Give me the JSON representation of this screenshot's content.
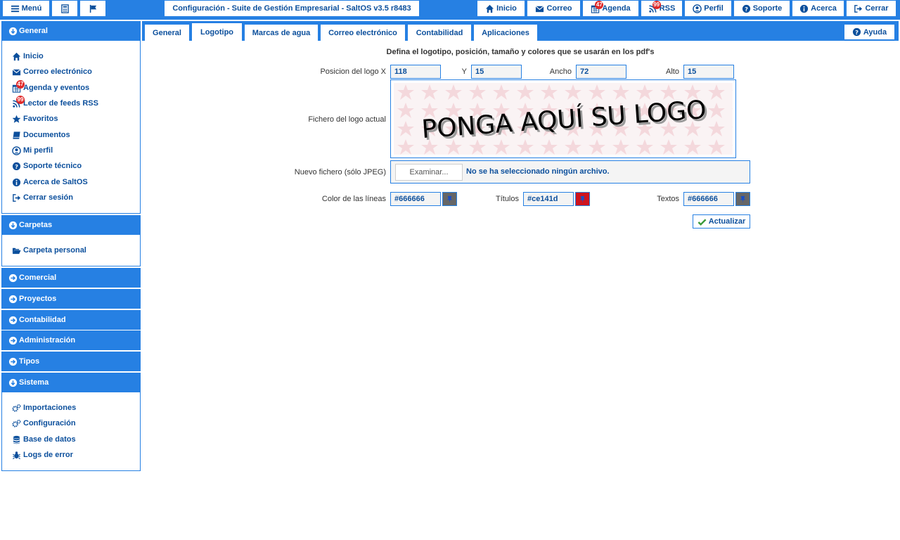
{
  "topbar": {
    "menu": "Menú",
    "title": "Configuración - Suite de Gestión Empresarial - SaltOS v3.5 r8483",
    "inicio": "Inicio",
    "correo": "Correo",
    "agenda": "Agenda",
    "agenda_badge": "47",
    "rss": "RSS",
    "rss_badge": "99",
    "perfil": "Perfil",
    "soporte": "Soporte",
    "acerca": "Acerca",
    "cerrar": "Cerrar"
  },
  "sidebar": {
    "general": {
      "title": "General",
      "items": [
        "Inicio",
        "Correo electrónico",
        "Agenda y eventos",
        "Lector de feeds RSS",
        "Favoritos",
        "Documentos",
        "Mi perfil",
        "Soporte técnico",
        "Acerca de SaltOS",
        "Cerrar sesión"
      ],
      "agenda_badge": "47",
      "rss_badge": "99"
    },
    "carpetas": {
      "title": "Carpetas",
      "items": [
        "Carpeta personal"
      ]
    },
    "collapsed": [
      "Comercial",
      "Proyectos",
      "Contabilidad",
      "Administración",
      "Tipos"
    ],
    "sistema": {
      "title": "Sistema",
      "items": [
        "Importaciones",
        "Configuración",
        "Base de datos",
        "Logs de error"
      ]
    }
  },
  "tabs": [
    "General",
    "Logotipo",
    "Marcas de agua",
    "Correo electrónico",
    "Contabilidad",
    "Aplicaciones"
  ],
  "active_tab": "Logotipo",
  "help": "Ayuda",
  "form": {
    "heading": "Defina el logotipo, posición, tamaño y colores que se usarán en los pdf's",
    "pos_x_label": "Posicion del logo X",
    "pos_x": "118",
    "y_label": "Y",
    "y": "15",
    "ancho_label": "Ancho",
    "ancho": "72",
    "alto_label": "Alto",
    "alto": "15",
    "logo_label": "Fichero del logo actual",
    "logo_text": "PONGA AQUÍ SU LOGO",
    "new_file_label": "Nuevo fichero (sólo JPEG)",
    "browse": "Examinar...",
    "no_file": "No se ha seleccionado ningún archivo.",
    "line_color_label": "Color de las líneas",
    "line_color": "#666666",
    "titles_label": "Títulos",
    "titles_color": "#ce141d",
    "texts_label": "Textos",
    "texts_color": "#666666",
    "update": "Actualizar"
  },
  "colors": {
    "accent": "#2680e3",
    "link": "#0b4f9c",
    "line_swatch": "#666666",
    "title_swatch": "#ce141d",
    "success": "#3a9a3a"
  }
}
